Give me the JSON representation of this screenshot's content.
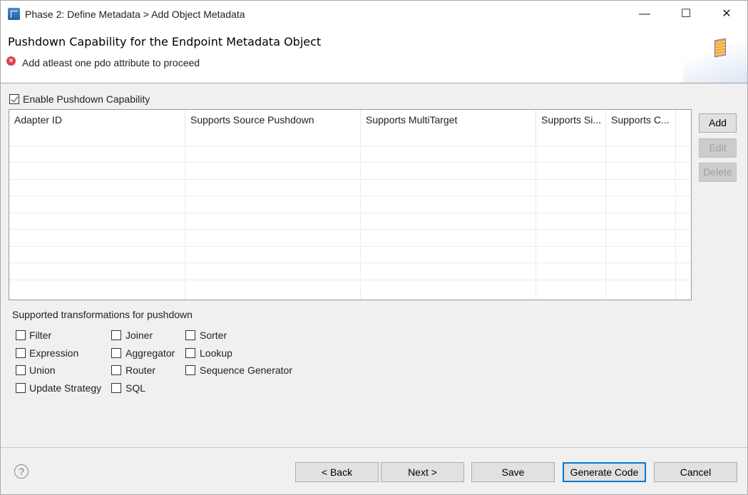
{
  "window": {
    "title": "Phase 2: Define Metadata > Add Object Metadata",
    "minimize": "—",
    "maximize": "☐",
    "close": "✕"
  },
  "header": {
    "title": "Pushdown Capability for the Endpoint Metadata Object",
    "error": "Add atleast one pdo attribute to proceed",
    "error_icon": "error-icon",
    "banner_icon": "table-icon"
  },
  "enable": {
    "label": "Enable Pushdown Capability",
    "checked": true
  },
  "table": {
    "columns": [
      "Adapter ID",
      "Supports Source Pushdown",
      "Supports MultiTarget",
      "Supports Si...",
      "Supports C..."
    ],
    "rows": []
  },
  "side_buttons": {
    "add": "Add",
    "edit": "Edit",
    "delete": "Delete"
  },
  "transformations": {
    "label": "Supported transformations for pushdown",
    "items": [
      {
        "label": "Filter",
        "checked": false
      },
      {
        "label": "Expression",
        "checked": false
      },
      {
        "label": "Union",
        "checked": false
      },
      {
        "label": "Update Strategy",
        "checked": false
      },
      {
        "label": "Joiner",
        "checked": false
      },
      {
        "label": "Aggregator",
        "checked": false
      },
      {
        "label": "Router",
        "checked": false
      },
      {
        "label": "SQL",
        "checked": false
      },
      {
        "label": "Sorter",
        "checked": false
      },
      {
        "label": "Lookup",
        "checked": false
      },
      {
        "label": "Sequence Generator",
        "checked": false
      }
    ]
  },
  "footer": {
    "help": "?",
    "back": "< Back",
    "next": "Next >",
    "save": "Save",
    "generate": "Generate Code",
    "cancel": "Cancel"
  }
}
